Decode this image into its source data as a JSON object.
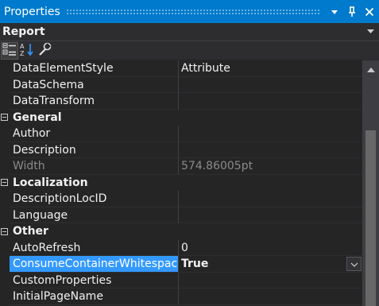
{
  "window": {
    "title": "Properties"
  },
  "object": {
    "name": "Report"
  },
  "colors": {
    "accent": "#007acc",
    "selection": "#3399ff",
    "background": "#252526"
  },
  "icons": {
    "titlebar": [
      "dropdown-arrow-icon",
      "pin-icon",
      "close-icon"
    ],
    "toolbar": [
      "categorized-icon",
      "alphabetical-icon",
      "property-pages-icon"
    ]
  },
  "properties": {
    "top_rows": [
      {
        "name": "DataElementStyle",
        "value": "Attribute"
      },
      {
        "name": "DataSchema",
        "value": ""
      },
      {
        "name": "DataTransform",
        "value": ""
      }
    ],
    "categories": [
      {
        "label": "General",
        "rows": [
          {
            "name": "Author",
            "value": ""
          },
          {
            "name": "Description",
            "value": ""
          },
          {
            "name": "Width",
            "value": "574.86005pt"
          }
        ]
      },
      {
        "label": "Localization",
        "rows": [
          {
            "name": "DescriptionLocID",
            "value": ""
          },
          {
            "name": "Language",
            "value": ""
          }
        ]
      },
      {
        "label": "Other",
        "rows": [
          {
            "name": "AutoRefresh",
            "value": "0"
          },
          {
            "name": "ConsumeContainerWhitespace",
            "value": "True"
          },
          {
            "name": "CustomProperties",
            "value": ""
          },
          {
            "name": "InitialPageName",
            "value": ""
          }
        ]
      }
    ]
  }
}
